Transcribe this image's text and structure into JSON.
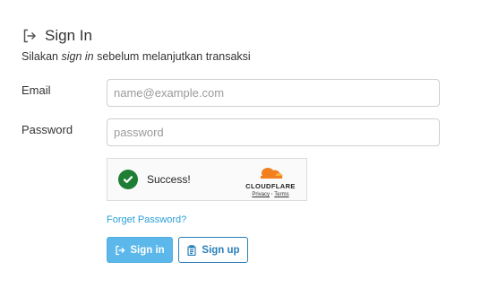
{
  "header": {
    "title": "Sign In",
    "subtitle_pre": "Silakan ",
    "subtitle_em": "sign in",
    "subtitle_post": " sebelum melanjutkan transaksi"
  },
  "form": {
    "email_label": "Email",
    "email_placeholder": "name@example.com",
    "email_value": "",
    "password_label": "Password",
    "password_placeholder": "password",
    "password_value": ""
  },
  "captcha": {
    "status_text": "Success!",
    "brand": "CLOUDFLARE",
    "privacy_link": "Privacy",
    "separator": "·",
    "terms_link": "Terms",
    "check_icon": "check-circle-icon",
    "brand_color": "#f38020"
  },
  "links": {
    "forget_password": "Forget Password?"
  },
  "buttons": {
    "signin_label": "Sign in",
    "signin_icon": "sign-in-icon",
    "signup_label": "Sign up",
    "signup_icon": "clipboard-icon"
  },
  "colors": {
    "primary": "#5cb8ea",
    "link": "#2a9fd6",
    "success": "#1e7e34"
  }
}
